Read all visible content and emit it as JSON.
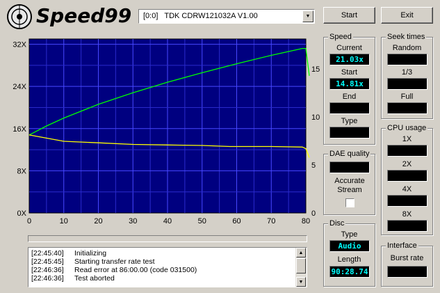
{
  "app": {
    "name": "Speed99"
  },
  "header": {
    "drive_select": "[0:0]   TDK CDRW121032A V1.00",
    "start_label": "Start",
    "exit_label": "Exit"
  },
  "speed": {
    "title": "Speed",
    "current_label": "Current",
    "current_value": "21.03x",
    "start_label": "Start",
    "start_value": "14.81x",
    "end_label": "End",
    "end_value": "",
    "type_label": "Type",
    "type_value": ""
  },
  "seek": {
    "title": "Seek times",
    "random_label": "Random",
    "third_label": "1/3",
    "full_label": "Full"
  },
  "cpu": {
    "title": "CPU usage",
    "labels": [
      "1X",
      "2X",
      "4X",
      "8X"
    ]
  },
  "dae": {
    "title": "DAE quality",
    "accurate_label": "Accurate Stream"
  },
  "disc": {
    "title": "Disc",
    "type_label": "Type",
    "type_value": "Audio",
    "length_label": "Length",
    "length_value": "90:28.74"
  },
  "interface": {
    "title": "Interface",
    "burst_label": "Burst rate"
  },
  "log": [
    {
      "time": "[22:45:40]",
      "msg": "Initializing"
    },
    {
      "time": "[22:45:45]",
      "msg": "Starting transfer rate test"
    },
    {
      "time": "[22:46:36]",
      "msg": "Read error at 86:00.00 (code 031500)"
    },
    {
      "time": "[22:46:36]",
      "msg": "Test aborted"
    }
  ],
  "chart_data": {
    "type": "line",
    "x_ticks": [
      "0",
      "10",
      "20",
      "30",
      "40",
      "50",
      "60",
      "70",
      "80"
    ],
    "y_left_ticks": [
      "0X",
      "8X",
      "16X",
      "24X",
      "32X"
    ],
    "y_right_ticks": [
      "0",
      "5",
      "10",
      "15"
    ],
    "xlim": [
      0,
      80
    ],
    "ylim_left": [
      0,
      33
    ],
    "ylim_right": [
      0,
      18.1
    ],
    "grid": true,
    "background": "#000080",
    "series": [
      {
        "color": "#00ff00",
        "axis": "left",
        "x": [
          0,
          5,
          10,
          20,
          30,
          40,
          50,
          60,
          70,
          79,
          80,
          81
        ],
        "y": [
          14.8,
          16.5,
          18.0,
          20.6,
          22.8,
          24.8,
          26.6,
          28.3,
          29.9,
          31.2,
          31.2,
          26.0
        ]
      },
      {
        "color": "#ffff00",
        "axis": "left",
        "x": [
          0,
          10,
          20,
          30,
          40,
          50,
          58,
          60,
          70,
          79,
          80,
          81
        ],
        "y": [
          14.8,
          13.6,
          13.3,
          13.0,
          12.9,
          12.8,
          12.6,
          12.6,
          12.6,
          12.5,
          12.2,
          10.5
        ]
      }
    ]
  }
}
